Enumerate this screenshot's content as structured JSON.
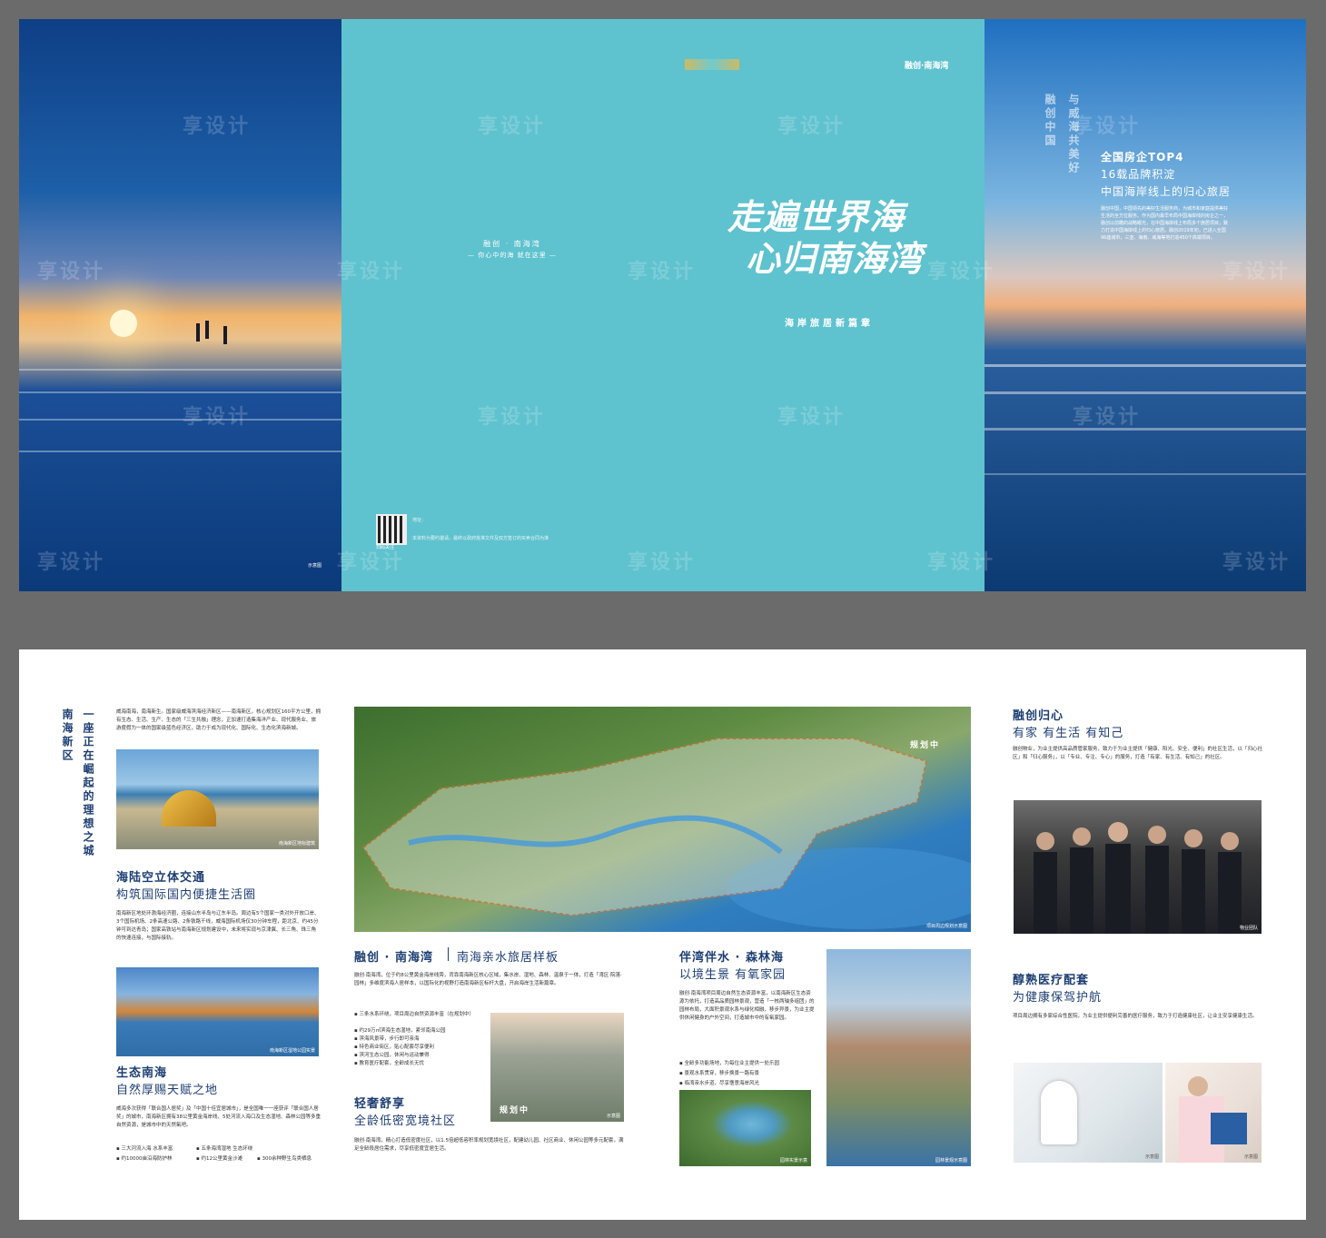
{
  "top": {
    "left_panel": {
      "caption": "示意图"
    },
    "center_panel": {
      "logo_text": "融创·南海湾",
      "slogan_1": "融创 · 南海湾",
      "slogan_2": "— 你心中的海 就在这里 —",
      "headline_1": "走遍世界海",
      "headline_2": "心归南海湾",
      "subtitle": "海岸旅居新篇章",
      "qr_label": "扫码关注",
      "footer_text_1": "地址：",
      "footer_text_2": "本资料为要约邀请，最终以政府批准文件及双方签订的买卖合同为准"
    },
    "right_panel": {
      "vert_1": "融创中国",
      "vert_2": "与威海共美好",
      "title_1": "全国房企TOP4",
      "title_2": "16载品牌积淀",
      "title_3": "中国海岸线上的归心旅居",
      "body": "融创中国，中国领先的美好生活服务商，为城市和家庭提供美好生活的全方位服务。作为国内最早布局中国海岸线的房企之一，融创以前瞻的战略眼光，在中国海岸线上布局多个旅居项目，致力打造中国海岸线上的归心旅居。融创2019年初，已进入全国96座城市，三亚、海南、威海等地打造450个高端项目。"
    },
    "watermark": "享设计"
  },
  "bottom": {
    "col1": {
      "vert_title": "南海新区",
      "vert_sub": "一座正在崛起的理想之城",
      "intro": "威海南海，南海新生。国家级威海滨海经济新区——南海新区，核心规划区160平方公里，拥有生态、生活、生产、生态的「三生共融」理念，正加速打造集海洋产业、现代服务业、旅游度假为一体的国家级蓝色经济区，助力于成为现代化、国际化、生态化滨海新城。",
      "img1_caption": "南海新区地标建筑",
      "h_traffic": "海陆空立体交通",
      "h_traffic_sub": "构筑国际国内便捷生活圈",
      "traffic_body": "南海新区地处环渤海经济圈，连接山东半岛与辽东半岛。周边有5个国家一类对外开放口岸、3个国际机场、2条高速公路、2条铁路干线，威海国际机场仅30分钟车程，距北京、约45分钟可到达青岛；国家高铁站与南海新区规划建设中，未来将实现与京津冀、长三角、珠三角的快速连接，与国际接轨。",
      "img2_caption": "南海新区湿地公园实景",
      "h_eco": "生态南海",
      "h_eco_sub": "自然厚赐天赋之地",
      "eco_body": "威海多次获得「联合国人居奖」及「中国十佳宜居城市」，是全国唯一一座获评「联合国人居奖」的城市，南海新区拥有38公里黄金海岸线、5处河流入海口及生态湿地、森林公园等多重自然资源，是城市中的天然氧吧。",
      "bullets": [
        "三大河流入海 水系丰富",
        "五条海湾湿地 生态环绕",
        "约10000亩沿海防护林",
        "约12公里黄金沙滩",
        "300余种野生鸟类栖息"
      ]
    },
    "col2": {
      "map_label": "规划中",
      "map_caption": "项目周边规划示意图",
      "title_main": "融创 · 南海湾",
      "title_sub": "南海亲水旅居样板",
      "intro": "融创·南海湾，位于约8公里黄金海岸线旁，背靠南海新区核心区域，集水岸、湿地、森林、温泉于一体，打造「湾区·院落·园林」多维度滨海人居样本，以国际化的视野打造南海新区标杆大盘，开启海岸生活新篇章。",
      "bullets": [
        "三条水系环绕，项目周边自然资源丰富（在规划中）",
        "约29万㎡滨海生态湿地，紧邻南海公园",
        "滨海风景带，步行即可亲海",
        "特色商业街区，贴心配套尽享便利",
        "滨河生态公园，休闲与运动兼得",
        "教育医疗配套，全龄成长无忧"
      ],
      "img_label": "规划中",
      "img_caption": "示意图",
      "h_luxe": "轻奢舒享",
      "h_luxe_sub": "全龄低密宽境社区",
      "luxe_body": "融创·南海湾，精心打造低密度社区，以1.5倍超低容积率规划宽境社区，配建幼儿园、社区商业、休闲公园等多元配套，满足全龄段居住需求，尽享低密度宜居生活。"
    },
    "col3": {
      "h_title": "伴湾伴水 · 森林海",
      "h_sub": "以境生景 有氧家园",
      "body": "融创·南海湾项目周边自然生态资源丰富，以南海新区生态资源为依托，打造高品质园林景观，营造「一核两轴多组团」的园林布局，大面积景观水系与绿化相融，移步异景，为业主提供休闲健身的户外空间，打造城市中的有氧家园。",
      "bullets": [
        "全龄多功能场地，为每位业主提供一处乐园",
        "景观水系贯穿，移步换景一路有景",
        "临湾亲水步道，尽享惬意海岸风光"
      ],
      "img_caption_a": "园林实景示意",
      "img_caption_b": "园林景观示意图"
    },
    "col4": {
      "h_title": "融创归心",
      "h_sub": "有家 有生活 有知己",
      "body": "融创物业，为业主提供高品质管家服务，致力于为业主提供「健康、阳光、安全、便利」的社区生活，以「归心社区」和「归心服务」，以「专业、专注、专心」的服务，打造「有家、有生活、有知己」的社区。",
      "img_caption": "物业团队",
      "h_med": "醇熟医疗配套",
      "h_med_sub": "为健康保驾护航",
      "med_body": "项目周边拥有多家综合性医院，为业主提供便利完善的医疗服务，致力于打造健康社区，让业主安享健康生活。",
      "img_caption_a": "示意图",
      "img_caption_b": "示意图"
    }
  },
  "colors": {
    "navy": "#1d3e73",
    "teal": "#5fc2cf",
    "orange_line": "#e8682c"
  }
}
